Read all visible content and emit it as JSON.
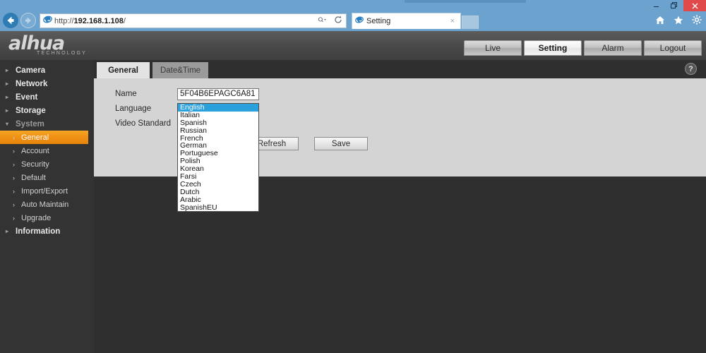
{
  "browser": {
    "address_value": "http://192.168.1.108/",
    "address_host": "192.168.1.108",
    "address_scheme": "http://",
    "address_path": "/",
    "back_icon": "back-arrow-icon",
    "forward_icon": "forward-arrow-icon",
    "site_icon": "ie-logo-icon",
    "search_icon": "search-magnifier-icon",
    "refresh_icon": "refresh-icon",
    "tab_title": "Setting",
    "tab_close_label": "×",
    "new_tab_label": "",
    "tools": [
      {
        "name": "home-icon",
        "glyph": "⌂"
      },
      {
        "name": "favorites-icon",
        "glyph": "★"
      },
      {
        "name": "settings-gear-icon",
        "glyph": "⚙"
      }
    ],
    "window_controls": [
      {
        "name": "minimize-button",
        "glyph": "–"
      },
      {
        "name": "restore-button",
        "glyph": "❐"
      },
      {
        "name": "close-button",
        "glyph": "✕"
      }
    ]
  },
  "app": {
    "logo_text": "alhua",
    "logo_sub": "TECHNOLOGY",
    "nav": [
      {
        "label": "Live",
        "active": false
      },
      {
        "label": "Setting",
        "active": true
      },
      {
        "label": "Alarm",
        "active": false
      },
      {
        "label": "Logout",
        "active": false
      }
    ]
  },
  "sidebar": {
    "items": [
      {
        "label": "Camera",
        "expanded": false
      },
      {
        "label": "Network",
        "expanded": false
      },
      {
        "label": "Event",
        "expanded": false
      },
      {
        "label": "Storage",
        "expanded": false
      },
      {
        "label": "System",
        "expanded": true
      }
    ],
    "system_children": [
      {
        "label": "General",
        "active": true
      },
      {
        "label": "Account",
        "active": false
      },
      {
        "label": "Security",
        "active": false
      },
      {
        "label": "Default",
        "active": false
      },
      {
        "label": "Import/Export",
        "active": false
      },
      {
        "label": "Auto Maintain",
        "active": false
      },
      {
        "label": "Upgrade",
        "active": false
      }
    ],
    "last_item": {
      "label": "Information",
      "expanded": false
    }
  },
  "content": {
    "tabs": [
      {
        "label": "General",
        "active": true
      },
      {
        "label": "Date&Time",
        "active": false
      }
    ],
    "help_glyph": "?",
    "labels": {
      "name": "Name",
      "language": "Language",
      "video_standard": "Video Standard"
    },
    "name_value": "5F04B6EPAGC6A81",
    "buttons": [
      {
        "label": "Refresh"
      },
      {
        "label": "Save"
      }
    ],
    "language_options": [
      "English",
      "Italian",
      "Spanish",
      "Russian",
      "French",
      "German",
      "Portuguese",
      "Polish",
      "Korean",
      "Farsi",
      "Czech",
      "Dutch",
      "Arabic",
      "SpanishEU"
    ],
    "language_selected": "English"
  },
  "colors": {
    "accent_orange": "#ef8f14",
    "selection_blue": "#2aa0dd",
    "chrome_blue": "#6ba3ce",
    "header_gray": "#4a4a4a",
    "panel_gray": "#d4d4d4",
    "sidebar_gray": "#333333"
  }
}
